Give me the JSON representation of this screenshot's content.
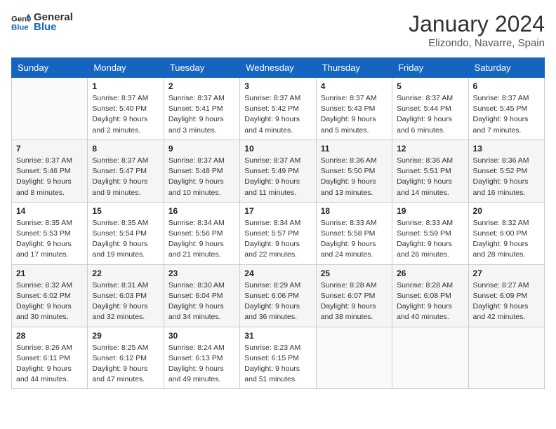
{
  "header": {
    "logo_line1": "General",
    "logo_line2": "Blue",
    "month_title": "January 2024",
    "location": "Elizondo, Navarre, Spain"
  },
  "weekdays": [
    "Sunday",
    "Monday",
    "Tuesday",
    "Wednesday",
    "Thursday",
    "Friday",
    "Saturday"
  ],
  "weeks": [
    [
      {
        "date": "",
        "info": ""
      },
      {
        "date": "1",
        "info": "Sunrise: 8:37 AM\nSunset: 5:40 PM\nDaylight: 9 hours\nand 2 minutes."
      },
      {
        "date": "2",
        "info": "Sunrise: 8:37 AM\nSunset: 5:41 PM\nDaylight: 9 hours\nand 3 minutes."
      },
      {
        "date": "3",
        "info": "Sunrise: 8:37 AM\nSunset: 5:42 PM\nDaylight: 9 hours\nand 4 minutes."
      },
      {
        "date": "4",
        "info": "Sunrise: 8:37 AM\nSunset: 5:43 PM\nDaylight: 9 hours\nand 5 minutes."
      },
      {
        "date": "5",
        "info": "Sunrise: 8:37 AM\nSunset: 5:44 PM\nDaylight: 9 hours\nand 6 minutes."
      },
      {
        "date": "6",
        "info": "Sunrise: 8:37 AM\nSunset: 5:45 PM\nDaylight: 9 hours\nand 7 minutes."
      }
    ],
    [
      {
        "date": "7",
        "info": "Sunrise: 8:37 AM\nSunset: 5:46 PM\nDaylight: 9 hours\nand 8 minutes."
      },
      {
        "date": "8",
        "info": "Sunrise: 8:37 AM\nSunset: 5:47 PM\nDaylight: 9 hours\nand 9 minutes."
      },
      {
        "date": "9",
        "info": "Sunrise: 8:37 AM\nSunset: 5:48 PM\nDaylight: 9 hours\nand 10 minutes."
      },
      {
        "date": "10",
        "info": "Sunrise: 8:37 AM\nSunset: 5:49 PM\nDaylight: 9 hours\nand 11 minutes."
      },
      {
        "date": "11",
        "info": "Sunrise: 8:36 AM\nSunset: 5:50 PM\nDaylight: 9 hours\nand 13 minutes."
      },
      {
        "date": "12",
        "info": "Sunrise: 8:36 AM\nSunset: 5:51 PM\nDaylight: 9 hours\nand 14 minutes."
      },
      {
        "date": "13",
        "info": "Sunrise: 8:36 AM\nSunset: 5:52 PM\nDaylight: 9 hours\nand 16 minutes."
      }
    ],
    [
      {
        "date": "14",
        "info": "Sunrise: 8:35 AM\nSunset: 5:53 PM\nDaylight: 9 hours\nand 17 minutes."
      },
      {
        "date": "15",
        "info": "Sunrise: 8:35 AM\nSunset: 5:54 PM\nDaylight: 9 hours\nand 19 minutes."
      },
      {
        "date": "16",
        "info": "Sunrise: 8:34 AM\nSunset: 5:56 PM\nDaylight: 9 hours\nand 21 minutes."
      },
      {
        "date": "17",
        "info": "Sunrise: 8:34 AM\nSunset: 5:57 PM\nDaylight: 9 hours\nand 22 minutes."
      },
      {
        "date": "18",
        "info": "Sunrise: 8:33 AM\nSunset: 5:58 PM\nDaylight: 9 hours\nand 24 minutes."
      },
      {
        "date": "19",
        "info": "Sunrise: 8:33 AM\nSunset: 5:59 PM\nDaylight: 9 hours\nand 26 minutes."
      },
      {
        "date": "20",
        "info": "Sunrise: 8:32 AM\nSunset: 6:00 PM\nDaylight: 9 hours\nand 28 minutes."
      }
    ],
    [
      {
        "date": "21",
        "info": "Sunrise: 8:32 AM\nSunset: 6:02 PM\nDaylight: 9 hours\nand 30 minutes."
      },
      {
        "date": "22",
        "info": "Sunrise: 8:31 AM\nSunset: 6:03 PM\nDaylight: 9 hours\nand 32 minutes."
      },
      {
        "date": "23",
        "info": "Sunrise: 8:30 AM\nSunset: 6:04 PM\nDaylight: 9 hours\nand 34 minutes."
      },
      {
        "date": "24",
        "info": "Sunrise: 8:29 AM\nSunset: 6:06 PM\nDaylight: 9 hours\nand 36 minutes."
      },
      {
        "date": "25",
        "info": "Sunrise: 8:28 AM\nSunset: 6:07 PM\nDaylight: 9 hours\nand 38 minutes."
      },
      {
        "date": "26",
        "info": "Sunrise: 8:28 AM\nSunset: 6:08 PM\nDaylight: 9 hours\nand 40 minutes."
      },
      {
        "date": "27",
        "info": "Sunrise: 8:27 AM\nSunset: 6:09 PM\nDaylight: 9 hours\nand 42 minutes."
      }
    ],
    [
      {
        "date": "28",
        "info": "Sunrise: 8:26 AM\nSunset: 6:11 PM\nDaylight: 9 hours\nand 44 minutes."
      },
      {
        "date": "29",
        "info": "Sunrise: 8:25 AM\nSunset: 6:12 PM\nDaylight: 9 hours\nand 47 minutes."
      },
      {
        "date": "30",
        "info": "Sunrise: 8:24 AM\nSunset: 6:13 PM\nDaylight: 9 hours\nand 49 minutes."
      },
      {
        "date": "31",
        "info": "Sunrise: 8:23 AM\nSunset: 6:15 PM\nDaylight: 9 hours\nand 51 minutes."
      },
      {
        "date": "",
        "info": ""
      },
      {
        "date": "",
        "info": ""
      },
      {
        "date": "",
        "info": ""
      }
    ]
  ]
}
